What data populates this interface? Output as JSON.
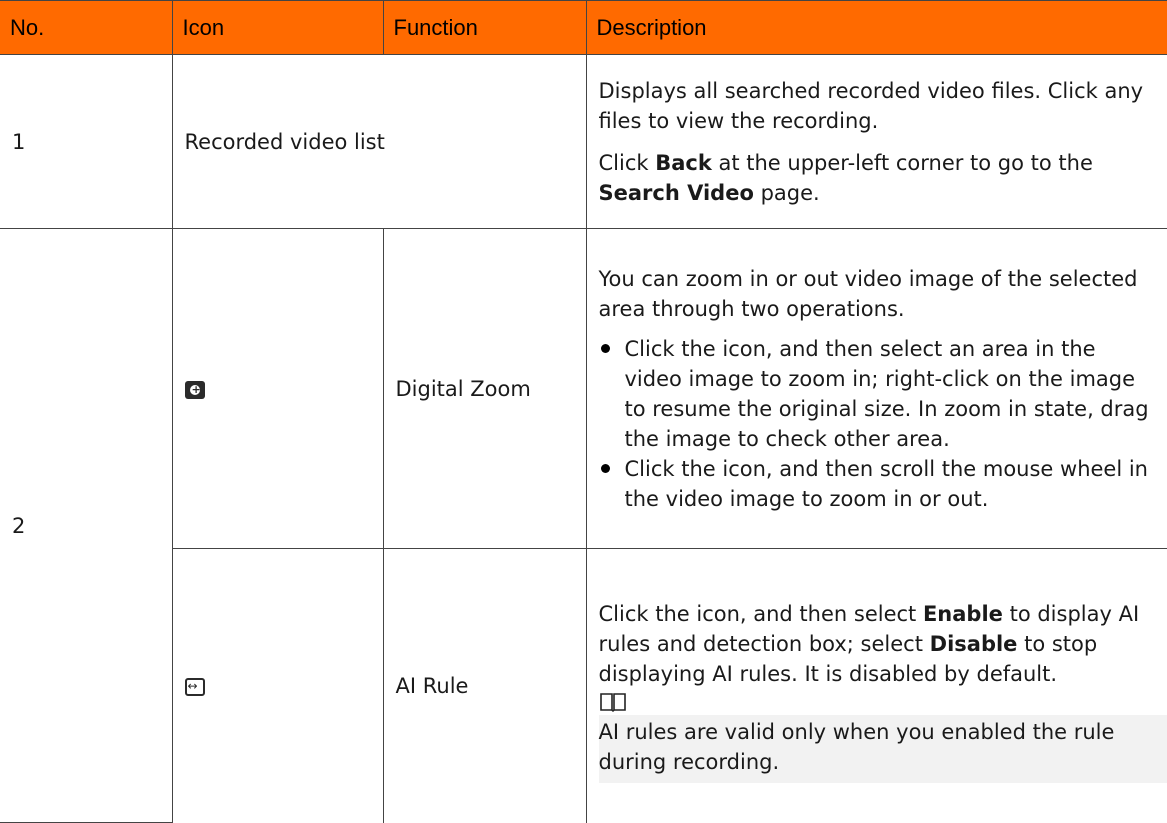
{
  "table": {
    "headers": {
      "no": "No.",
      "icon": "Icon",
      "function": "Function",
      "description": "Description"
    },
    "row1": {
      "no": "1",
      "merged_label": "Recorded video list",
      "desc_p1": "Displays all searched recorded video files. Click any files to view the recording.",
      "desc_p2_prefix": "Click ",
      "desc_p2_bold1": "Back",
      "desc_p2_mid": "  at the upper-left corner to go to the ",
      "desc_p2_bold2": "Search Video",
      "desc_p2_suffix": " page."
    },
    "row2": {
      "no": "2",
      "zoom": {
        "icon_name": "digital-zoom-icon",
        "function": "Digital Zoom",
        "intro": "You can zoom in or out video image of the selected area through two operations.",
        "bullet1": "Click the icon, and then select an area in the video image to zoom in; right-click on the image to resume the original size. In zoom in state, drag the image to check other area.",
        "bullet2": "Click the icon, and then scroll the mouse wheel in the video image to zoom in or out."
      },
      "ai_rule": {
        "icon_name": "ai-rule-icon",
        "function": "AI Rule",
        "desc_prefix": "Click the icon, and then select ",
        "desc_bold1": "Enable",
        "desc_mid": "  to display AI rules and detection box; select ",
        "desc_bold2": "Disable",
        "desc_suffix": " to stop displaying AI rules. It is disabled by default.",
        "note": "AI rules are valid only when you enabled the rule during recording."
      }
    }
  },
  "colors": {
    "header_bg": "#ff6a00",
    "border": "#444444",
    "note_bg": "#f2f2f2"
  }
}
